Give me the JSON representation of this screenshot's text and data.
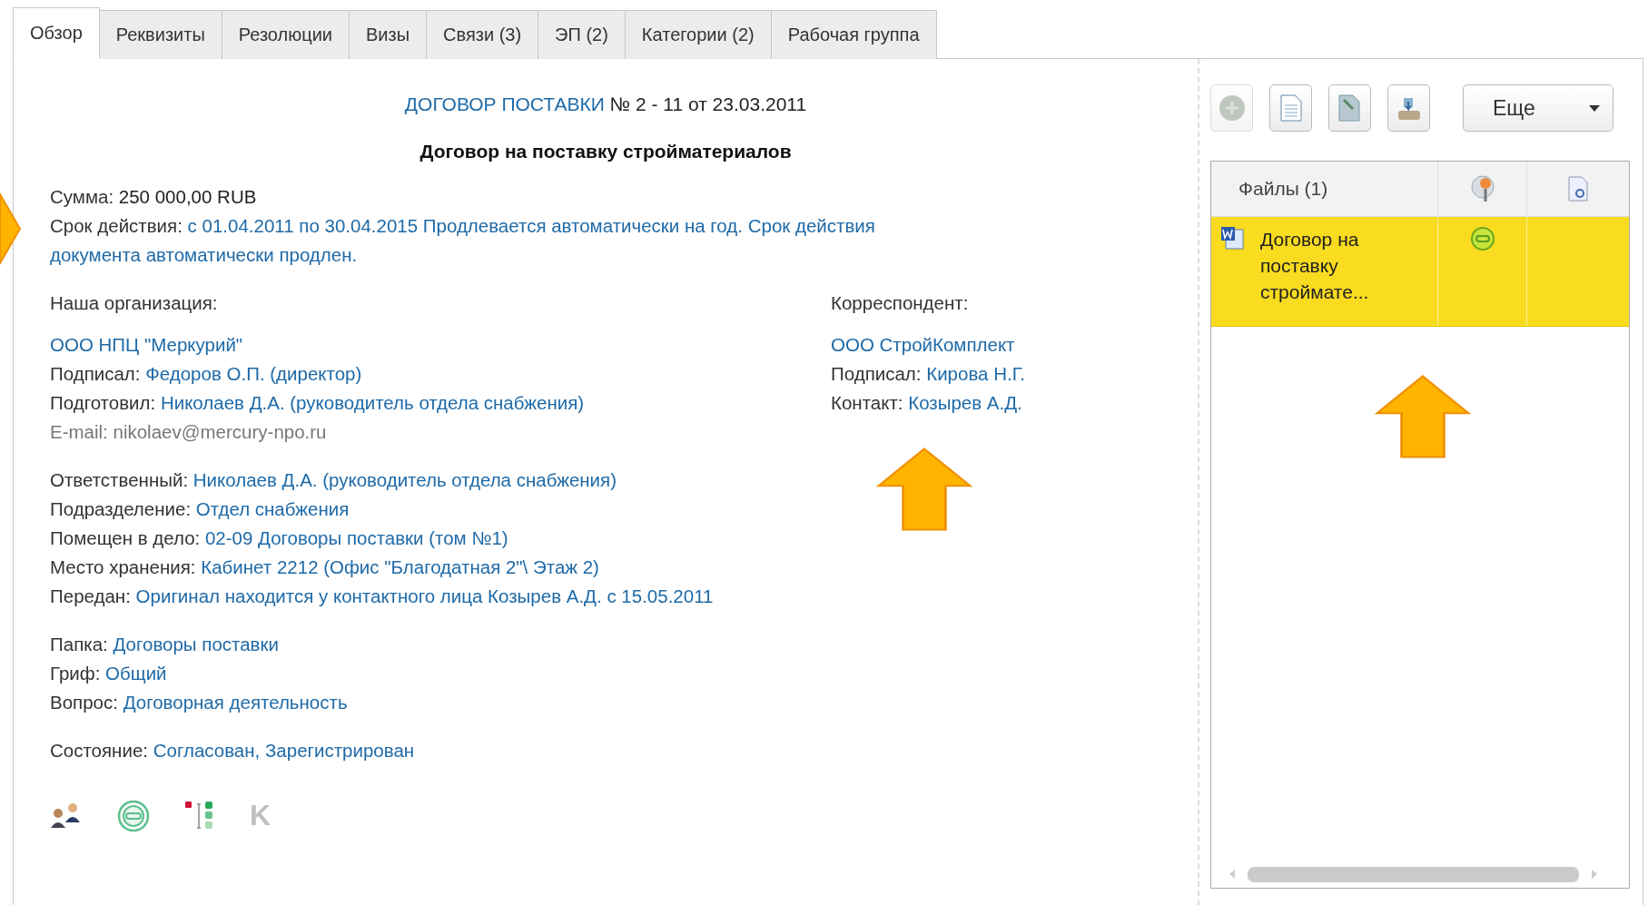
{
  "tabs": [
    {
      "label": "Обзор",
      "selected": true
    },
    {
      "label": "Реквизиты",
      "selected": false
    },
    {
      "label": "Резолюции",
      "selected": false
    },
    {
      "label": "Визы",
      "selected": false
    },
    {
      "label": "Связи (3)",
      "selected": false
    },
    {
      "label": "ЭП (2)",
      "selected": false
    },
    {
      "label": "Категории (2)",
      "selected": false
    },
    {
      "label": "Рабочая группа",
      "selected": false
    }
  ],
  "document": {
    "type_link": "ДОГОВОР ПОСТАВКИ",
    "number": "№ 2 - 11 от 23.03.2011",
    "subject": "Договор на поставку стройматериалов"
  },
  "summary": [
    {
      "label": "Сумма:",
      "value": "250 000,00 RUB",
      "kind": "text"
    },
    {
      "label": "Срок действия:",
      "value": "с 01.04.2011 по 30.04.2015 Продлевается автоматически на год. Срок действия документа автоматически продлен.",
      "kind": "link"
    }
  ],
  "our_organization": {
    "heading": "Наша организация:",
    "name": "ООО НПЦ \"Меркурий\"",
    "fields": [
      {
        "label": "Подписал:",
        "value": "Федоров О.П. (директор)",
        "kind": "link"
      },
      {
        "label": "Подготовил:",
        "value": "Николаев Д.А. (руководитель отдела снабжения)",
        "kind": "link"
      },
      {
        "label": "E-mail:",
        "value": "nikolaev@mercury-npo.ru",
        "kind": "muted"
      }
    ]
  },
  "correspondent": {
    "heading": "Корреспондент:",
    "name": "ООО СтройКомплект",
    "fields": [
      {
        "label": "Подписал:",
        "value": "Кирова Н.Г.",
        "kind": "link"
      },
      {
        "label": "Контакт:",
        "value": "Козырев А.Д.",
        "kind": "link"
      }
    ]
  },
  "field_groups": [
    [
      {
        "label": "Ответственный:",
        "value": "Николаев Д.А. (руководитель отдела снабжения)",
        "kind": "link"
      },
      {
        "label": "Подразделение:",
        "value": "Отдел снабжения",
        "kind": "link"
      },
      {
        "label": "Помещен в дело:",
        "value": "02-09 Договоры поставки (том №1)",
        "kind": "link"
      },
      {
        "label": "Место хранения:",
        "value": "Кабинет 2212 (Офис \"Благодатная 2\"\\ Этаж 2)",
        "kind": "link"
      },
      {
        "label": "Передан:",
        "value": "Оригинал находится у контактного лица Козырев А.Д. с 15.05.2011",
        "kind": "link"
      }
    ],
    [
      {
        "label": "Папка:",
        "value": "Договоры поставки",
        "kind": "link"
      },
      {
        "label": "Гриф:",
        "value": "Общий",
        "kind": "link"
      },
      {
        "label": "Вопрос:",
        "value": "Договорная деятельность",
        "kind": "link"
      }
    ],
    [
      {
        "label": "Состояние:",
        "value": "Согласован, Зарегистрирован",
        "kind": "link"
      }
    ]
  ],
  "bottom_icons": [
    {
      "kind": "people"
    },
    {
      "kind": "approved"
    },
    {
      "kind": "workflow"
    },
    {
      "kind": "letter",
      "text": "K"
    }
  ],
  "toolbar": {
    "buttons": [
      {
        "kind": "add",
        "disabled": true
      },
      {
        "kind": "document",
        "disabled": false
      },
      {
        "kind": "edit",
        "disabled": false
      },
      {
        "kind": "scan",
        "disabled": false
      }
    ],
    "more": "Еще"
  },
  "files": {
    "header": "Файлы (1)",
    "rows": [
      {
        "name": "Договор на поставку строймате...",
        "selected": true
      }
    ]
  }
}
